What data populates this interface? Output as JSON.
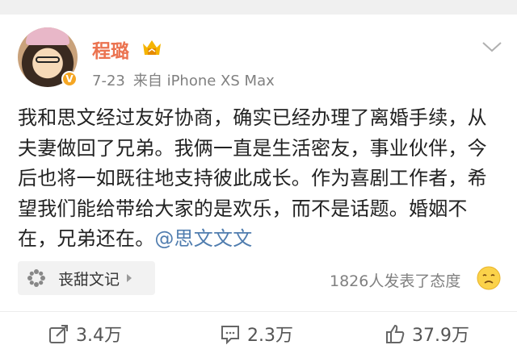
{
  "post": {
    "author": "程璐",
    "date": "7-23",
    "source": "来自 iPhone XS Max",
    "content_text": "我和思文经过友好协商，确实已经办理了离婚手续，从夫妻做回了兄弟。我俩一直是生活密友，事业伙伴，今后也将一如既往地支持彼此成长。作为喜剧工作者，希望我们能给带给大家的是欢乐，而不是话题。婚姻不在，兄弟还在。",
    "mention": "@思文文文",
    "verified_mark": "V"
  },
  "topic_chip": {
    "label": "丧甜文记"
  },
  "reactions": {
    "text": "1826人发表了态度"
  },
  "actions": {
    "repost": "3.4万",
    "comment": "2.3万",
    "like": "37.9万"
  },
  "colors": {
    "username": "#eb7350",
    "mention": "#507daf",
    "verified": "#f5a623"
  },
  "icons": [
    "chevron-down-icon",
    "vip-crown-icon",
    "verified-icon",
    "pinwheel-icon",
    "arrow-right-icon",
    "emoji-icon",
    "repost-icon",
    "comment-icon",
    "like-icon"
  ]
}
